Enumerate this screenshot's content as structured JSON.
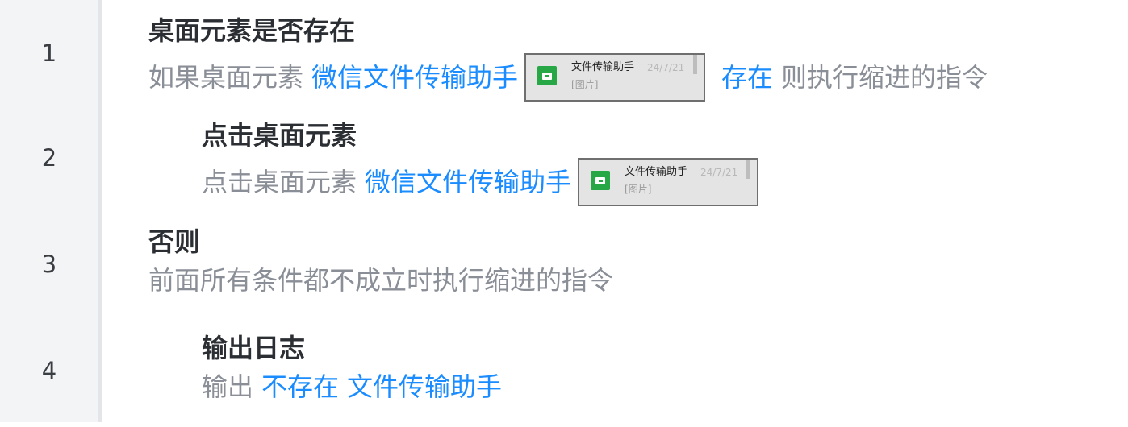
{
  "lines": [
    {
      "number": "1",
      "title": "桌面元素是否存在",
      "desc_prefix": "如果桌面元素",
      "target": "微信文件传输助手",
      "thumb": {
        "name": "文件传输助手",
        "date": "24/7/21",
        "sub": "[图片]",
        "icon": "wechat-file-transfer-icon"
      },
      "condition": "存在",
      "desc_suffix": "则执行缩进的指令"
    },
    {
      "number": "2",
      "title": "点击桌面元素",
      "desc_prefix": "点击桌面元素",
      "target": "微信文件传输助手",
      "thumb": {
        "name": "文件传输助手",
        "date": "24/7/21",
        "sub": "[图片]",
        "icon": "wechat-file-transfer-icon"
      }
    },
    {
      "number": "3",
      "title": "否则",
      "desc": "前面所有条件都不成立时执行缩进的指令"
    },
    {
      "number": "4",
      "title": "输出日志",
      "desc_prefix": "输出",
      "value1": "不存在",
      "value2": "文件传输助手"
    }
  ],
  "colors": {
    "link": "#1a8cff",
    "title": "#2b2e33",
    "desc": "#8a8e96",
    "gutter": "#f3f4f6",
    "icon_green": "#28a746"
  }
}
